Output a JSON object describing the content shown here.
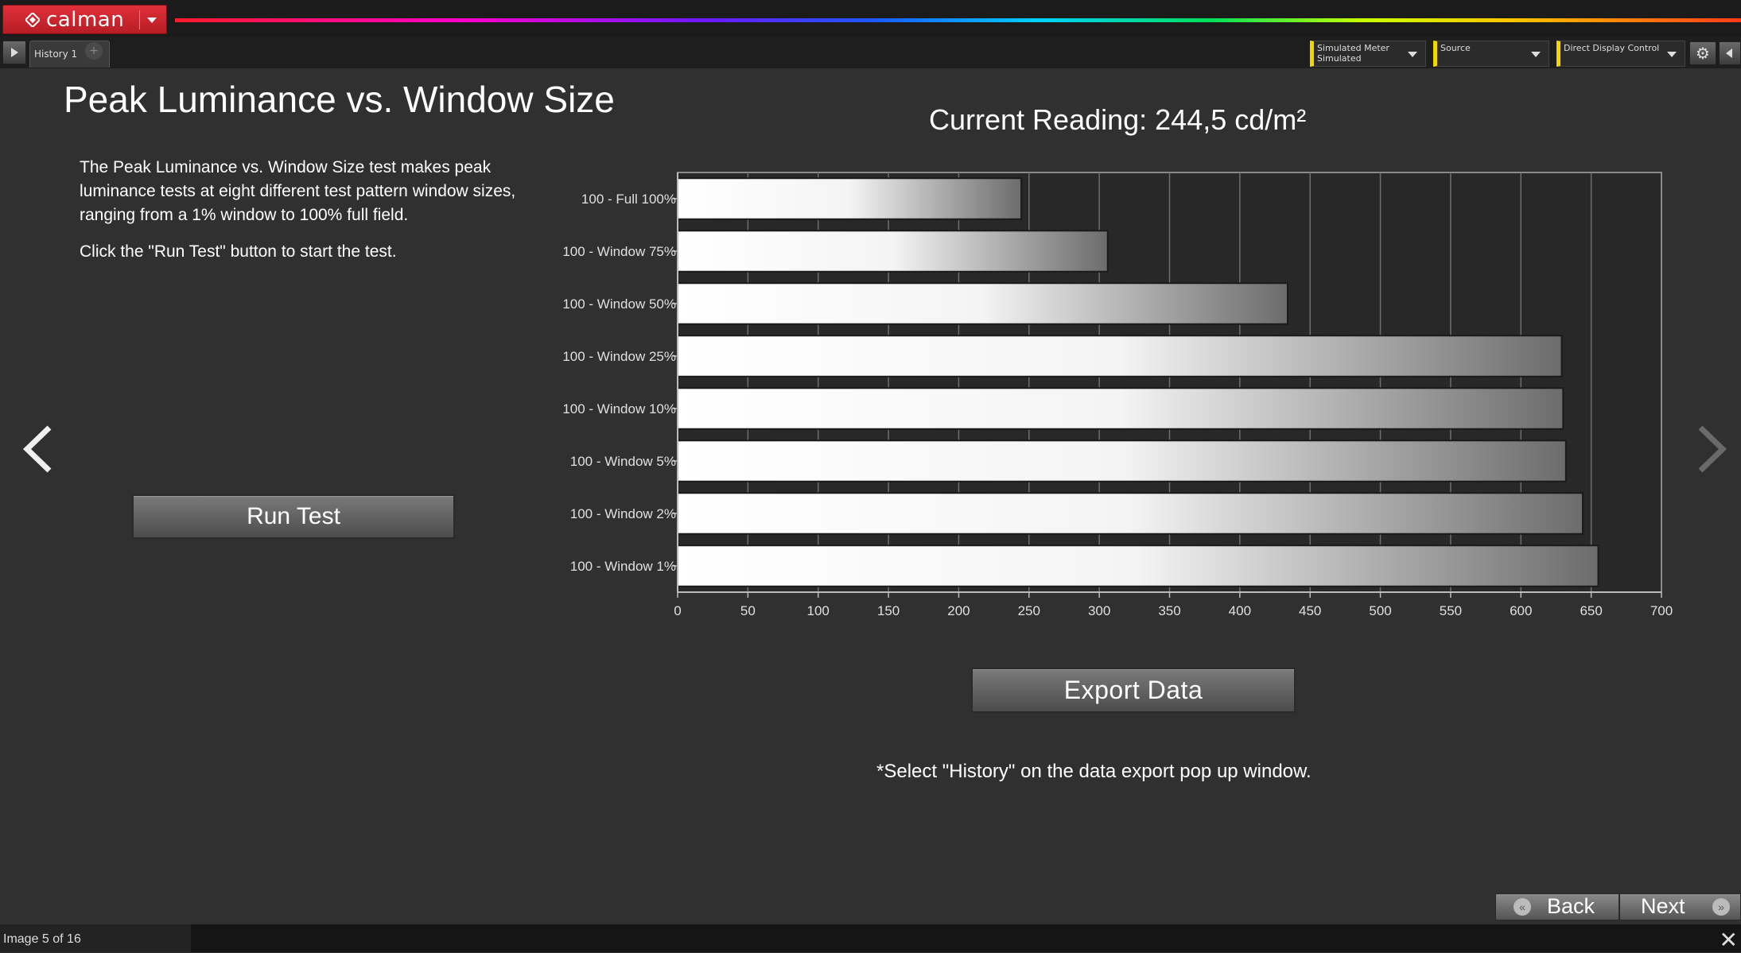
{
  "app": {
    "logo_text": "calman",
    "brand_color": "#d0232d"
  },
  "tabs": [
    {
      "label": "History 1"
    }
  ],
  "toolbar": {
    "meter": {
      "line1": "Simulated Meter",
      "line2": "Simulated"
    },
    "source": {
      "line1": "Source"
    },
    "display": {
      "line1": "Direct Display Control"
    }
  },
  "main": {
    "title": "Peak Luminance vs. Window Size",
    "description": "The Peak Luminance vs. Window Size test makes peak luminance tests at eight different test pattern window sizes, ranging from a 1% window to 100% full field.",
    "instruction": "Click the \"Run Test\" button to start the test.",
    "run_test_label": "Run Test",
    "current_reading": "Current Reading: 244,5 cd/m²",
    "export_label": "Export  Data",
    "footnote": "*Select \"History\" on the data export pop up window."
  },
  "chart_data": {
    "type": "bar",
    "orientation": "horizontal",
    "categories": [
      "100 - Full  100%",
      "100 - Window 75%",
      "100 - Window 50%",
      "100 - Window 25%",
      "100 - Window 10%",
      "100 - Window  5%",
      "100 - Window  2%",
      "100 - Window  1%"
    ],
    "values": [
      244.5,
      306,
      434,
      629,
      630,
      632,
      644,
      655
    ],
    "xlim": [
      0,
      700
    ],
    "x_ticks": [
      0,
      50,
      100,
      150,
      200,
      250,
      300,
      350,
      400,
      450,
      500,
      550,
      600,
      650,
      700
    ],
    "grid": true
  },
  "nav": {
    "back_label": "Back",
    "next_label": "Next"
  },
  "status": {
    "text": "Image 5 of 16"
  }
}
